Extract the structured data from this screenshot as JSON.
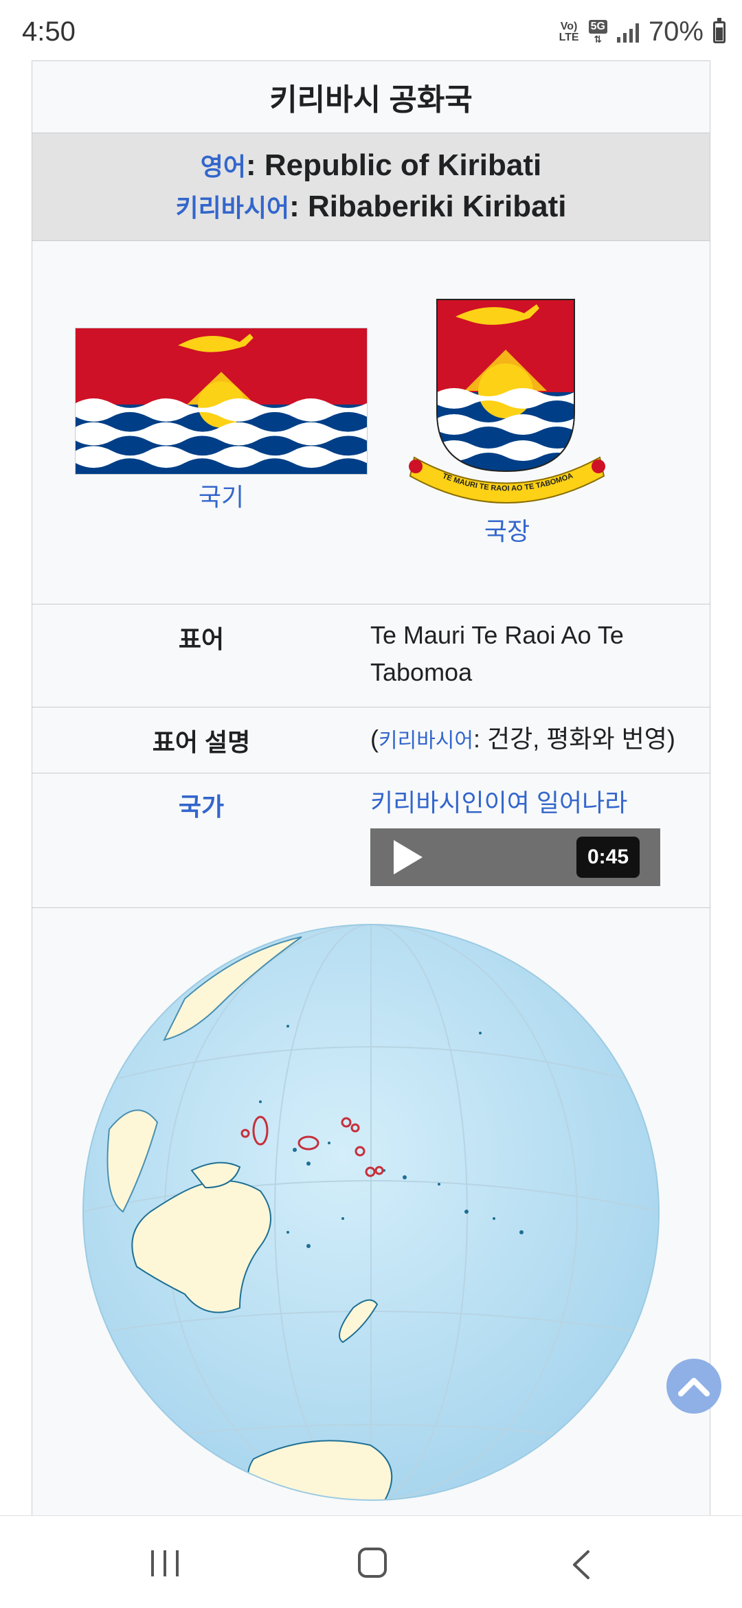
{
  "status_bar": {
    "time": "4:50",
    "volte_line1": "Vo)",
    "volte_line2": "LTE",
    "network": "5G",
    "battery_percent": "70%"
  },
  "infobox": {
    "title": "키리바시 공화국",
    "names": {
      "english_lang": "영어",
      "english_name": "Republic of Kiribati",
      "kiribati_lang": "키리바시어",
      "kiribati_name": "Ribaberiki Kiribati"
    },
    "flag_caption": "국기",
    "coat_caption": "국장",
    "coat_motto_scroll": "TE MAURI TE RAOI AO TE TABOMOA",
    "rows": {
      "motto_label": "표어",
      "motto_value": "Te Mauri Te Raoi Ao Te Tabomoa",
      "motto_desc_label": "표어 설명",
      "motto_desc_open": "(",
      "motto_desc_lang": "키리바시어",
      "motto_desc_text": ": 건강, 평화와 번영)",
      "anthem_label": "국가",
      "anthem_value": "키리바시인이여 일어나라",
      "anthem_duration": "0:45"
    }
  },
  "colors": {
    "link": "#3366cc",
    "flag_red": "#ce1126",
    "flag_blue": "#003f87",
    "flag_gold": "#fcd116",
    "ocean": "#c6e6f5",
    "land": "#fdf7d8",
    "highlight": "#c62f3a"
  },
  "icons": {
    "play": "play-icon",
    "scroll_top": "chevron-up-icon",
    "nav_recent": "recent-apps-icon",
    "nav_home": "home-icon",
    "nav_back": "back-icon"
  }
}
